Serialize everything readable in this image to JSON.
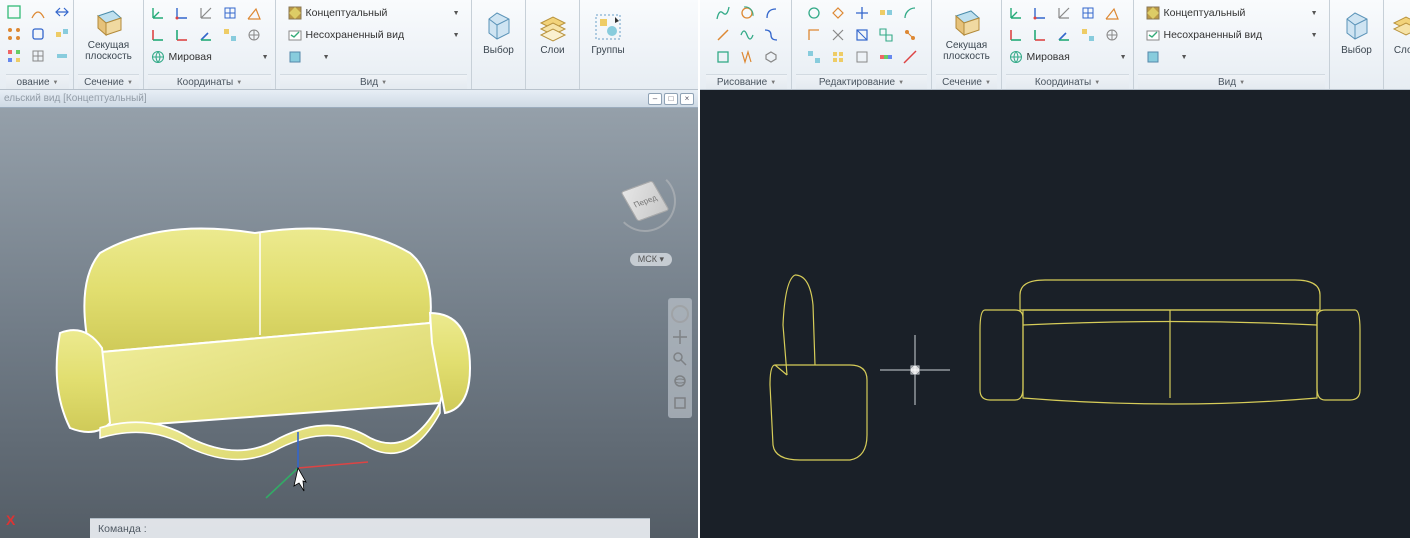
{
  "left": {
    "panels": {
      "drawing": "ование",
      "section_plane_btn": "Секущая\nплоскость",
      "section": "Сечение",
      "coords": "Координаты",
      "coord_rows": {
        "world": "Мировая"
      },
      "view": "Вид",
      "view_rows": {
        "conceptual": "Концептуальный",
        "unsaved": "Несохраненный вид"
      },
      "select": "Выбор",
      "layers": "Слои",
      "groups": "Группы"
    },
    "viewport": {
      "title_hint": "ельский вид [Концептуальный]",
      "cube_face": "Перед",
      "coord_sys": "МСК ▾",
      "command_label": "Команда :",
      "ucs_marker": "X"
    }
  },
  "right": {
    "panels": {
      "drawing": "Рисование",
      "editing": "Редактирование",
      "section_plane_btn": "Секущая\nплоскость",
      "section": "Сечение",
      "coords": "Координаты",
      "coord_rows": {
        "world": "Мировая"
      },
      "view": "Вид",
      "view_rows": {
        "conceptual": "Концептуальный",
        "unsaved": "Несохраненный вид"
      },
      "select": "Выбор",
      "layers": "Слои"
    }
  }
}
